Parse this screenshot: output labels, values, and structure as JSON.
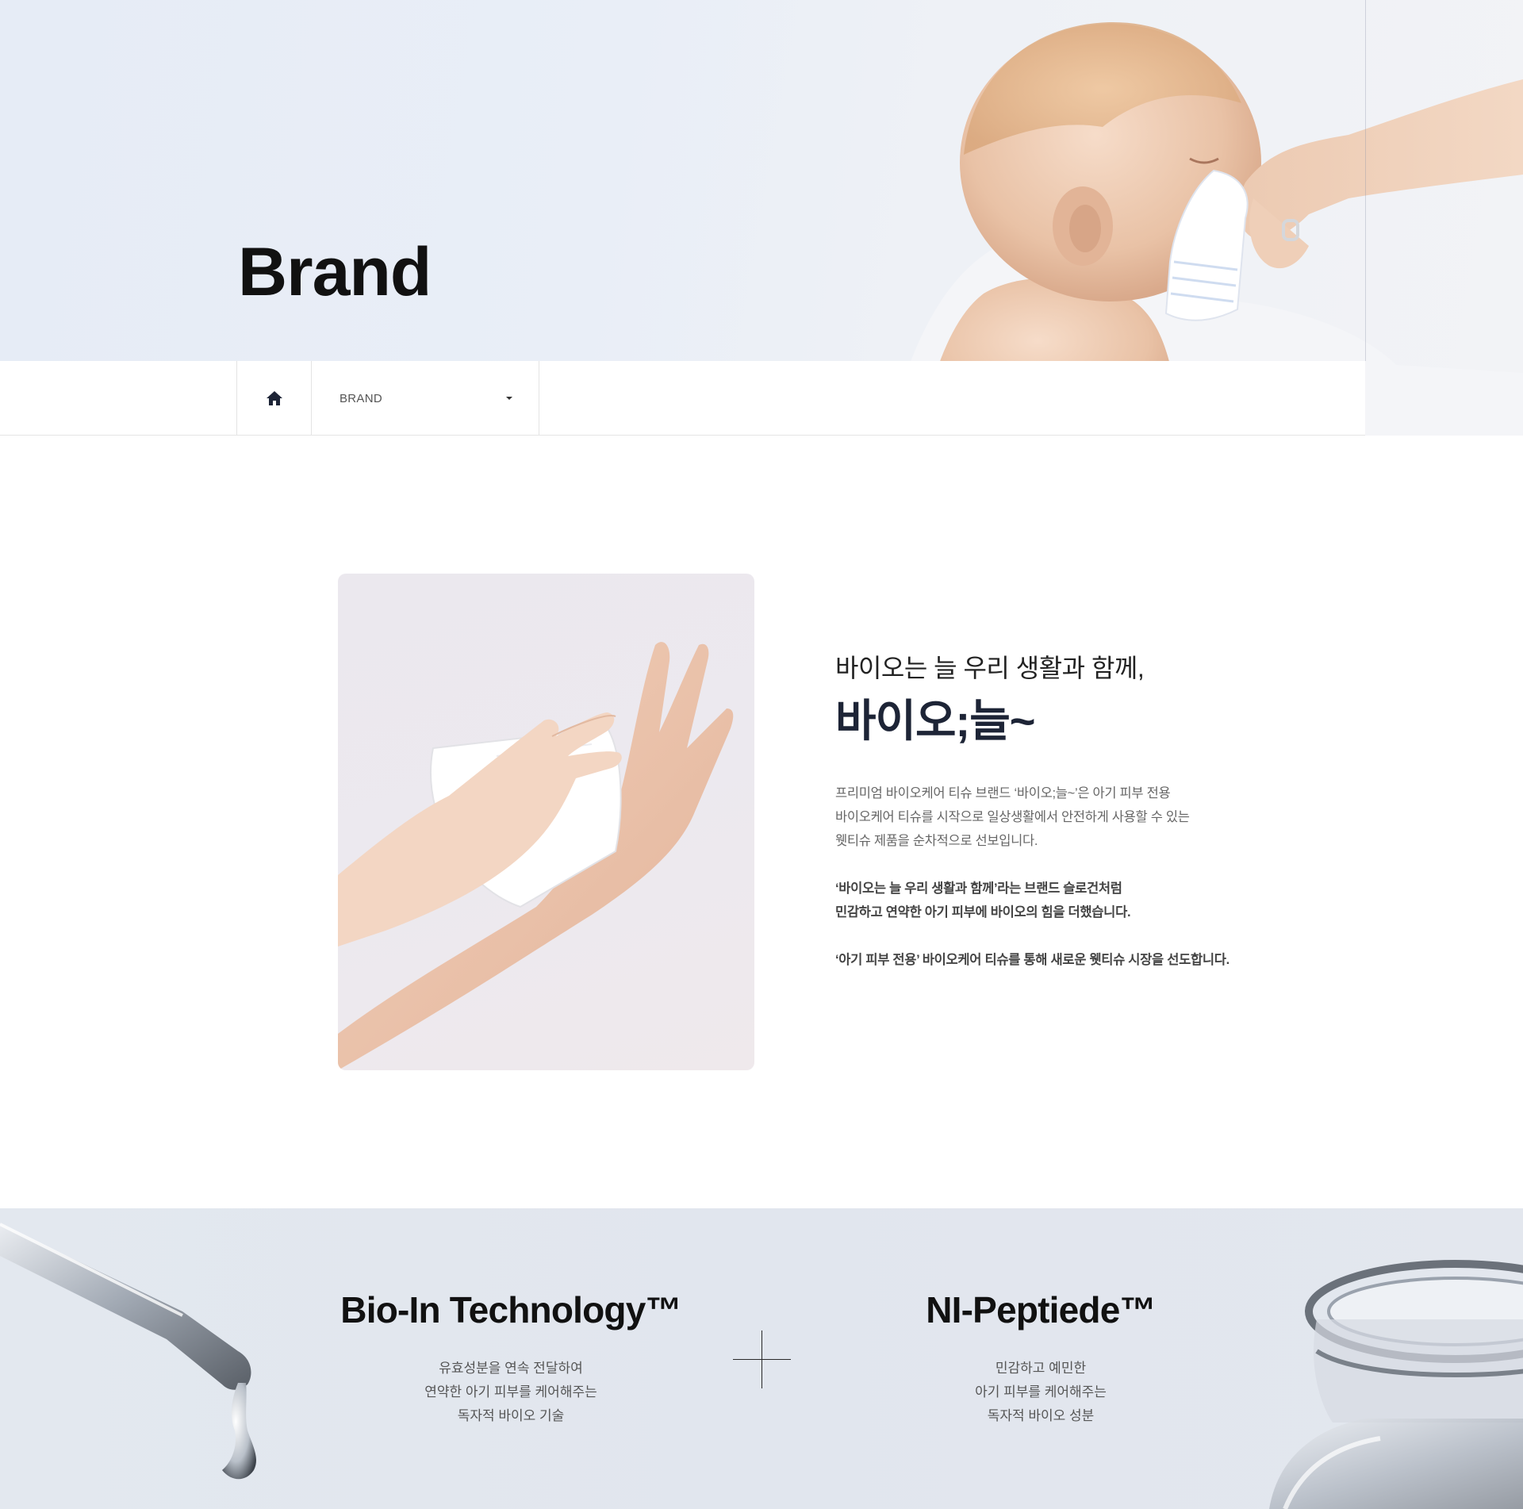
{
  "hero": {
    "title": "Brand"
  },
  "breadcrumb": {
    "home_icon": "home-icon",
    "current": "BRAND",
    "caret_icon": "caret-down-icon"
  },
  "intro": {
    "lead": "바이오는 늘 우리 생활과 함께,",
    "brand_name": "바이오;늘~",
    "paragraph1": [
      "프리미엄 바이오케어 티슈 브랜드 ‘바이오;늘~’은 아기 피부 전용",
      "바이오케어 티슈를 시작으로 일상생활에서 안전하게 사용할 수 있는",
      "웻티슈 제품을 순차적으로 선보입니다."
    ],
    "paragraph2": [
      "‘바이오는 늘 우리 생활과 함께’라는 브랜드 슬로건처럼",
      "민감하고 연약한 아기 피부에 바이오의 힘을 더했습니다."
    ],
    "paragraph3": [
      "‘아기 피부 전용’ 바이오케어 티슈를 통해 새로운 웻티슈 시장을 선도합니다."
    ]
  },
  "tech": {
    "left": {
      "title": "Bio-In Technology™",
      "desc": [
        "유효성분을 연속 전달하여",
        "연약한 아기 피부를 케어해주는",
        "독자적 바이오 기술"
      ]
    },
    "right": {
      "title": "NI-Peptiede™",
      "desc": [
        "민감하고 예민한",
        "아기 피부를 케어해주는",
        "독자적 바이오 성분"
      ]
    }
  },
  "colors": {
    "hero_bg": "#e8edf6",
    "brand_underline": "#c8d8ef",
    "tech_bg": "#e2e7ef",
    "title_dark": "#1d2436"
  }
}
